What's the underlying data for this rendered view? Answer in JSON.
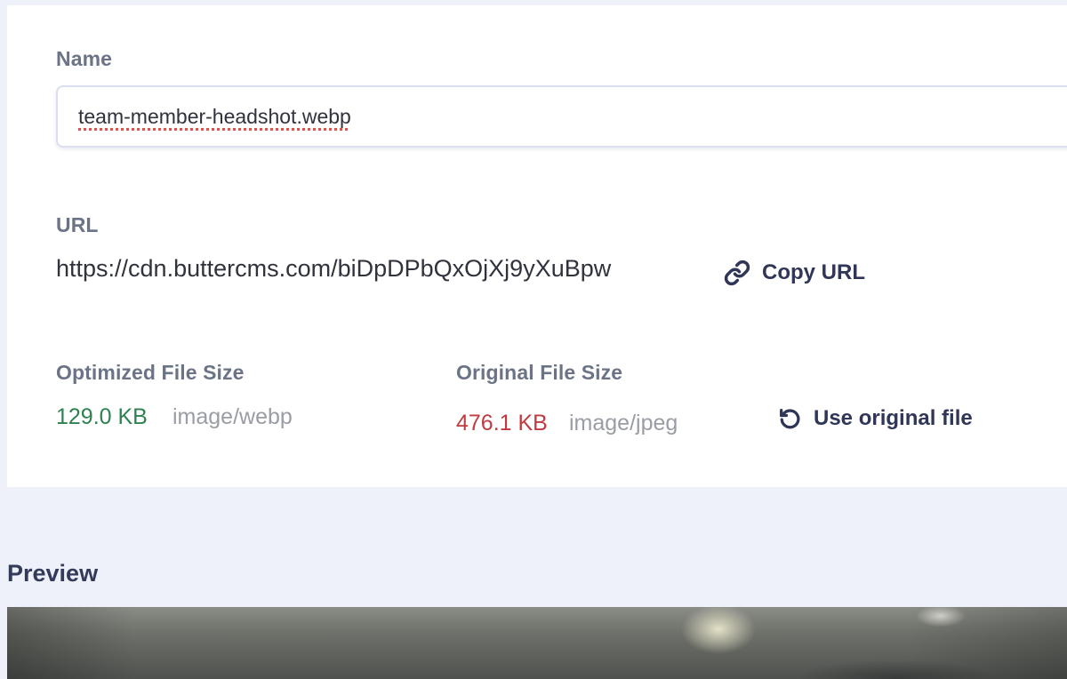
{
  "name_field": {
    "label": "Name",
    "value": "team-member-headshot.webp"
  },
  "url_field": {
    "label": "URL",
    "value": "https://cdn.buttercms.com/biDpDPbQxOjXj9yXuBpw",
    "copy_label": "Copy URL",
    "copy_icon": "link-icon"
  },
  "optimized": {
    "label": "Optimized File Size",
    "size": "129.0 KB",
    "mime": "image/webp",
    "color": "#2e8250"
  },
  "original": {
    "label": "Original File Size",
    "size": "476.1 KB",
    "mime": "image/jpeg",
    "color": "#c03a3f",
    "use_original_label": "Use original file",
    "use_original_icon": "undo-icon"
  },
  "preview": {
    "title": "Preview"
  }
}
